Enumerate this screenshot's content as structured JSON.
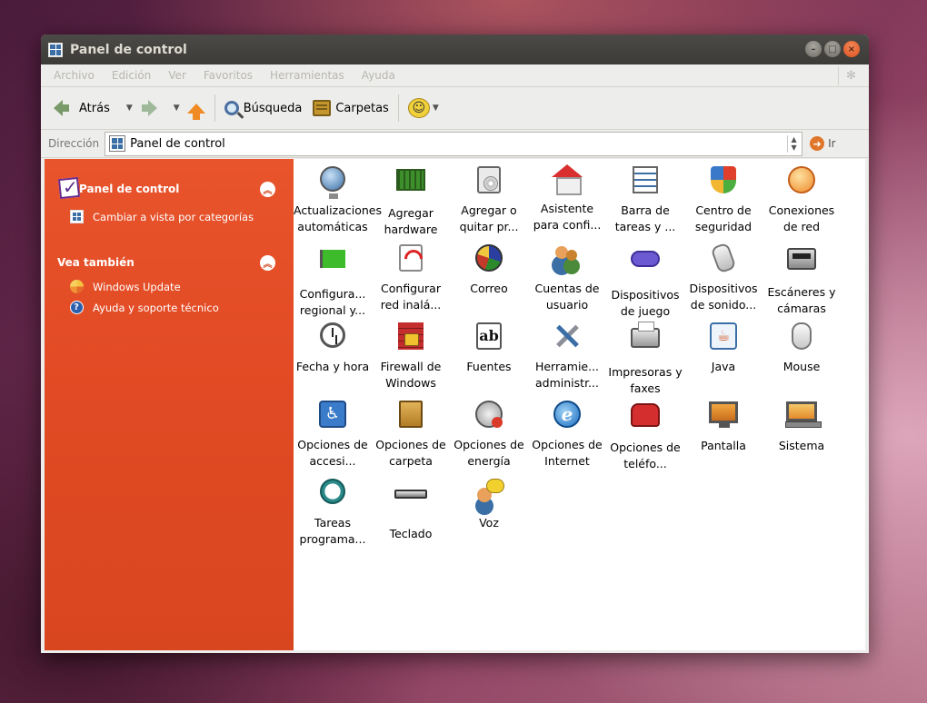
{
  "window": {
    "title": "Panel de control"
  },
  "menubar": {
    "items": [
      "Archivo",
      "Edición",
      "Ver",
      "Favoritos",
      "Herramientas",
      "Ayuda"
    ]
  },
  "toolbar": {
    "back_label": "Atrás",
    "search_label": "Búsqueda",
    "folders_label": "Carpetas"
  },
  "addressbar": {
    "label": "Dirección",
    "value": "Panel de control",
    "go_label": "Ir"
  },
  "sidebar": {
    "panel_title": "Panel de control",
    "panel_link": "Cambiar a vista por categorías",
    "see_also_title": "Vea también",
    "see_also_links": [
      "Windows Update",
      "Ayuda y soporte técnico"
    ]
  },
  "items": [
    {
      "label": "Actualizaciones automáticas",
      "icon": "globe"
    },
    {
      "label": "Agregar hardware",
      "icon": "board"
    },
    {
      "label": "Agregar o quitar pr...",
      "icon": "cd"
    },
    {
      "label": "Asistente para confi...",
      "icon": "house"
    },
    {
      "label": "Barra de tareas y ...",
      "icon": "taskbar"
    },
    {
      "label": "Centro de seguridad",
      "icon": "shield"
    },
    {
      "label": "Conexiones de red",
      "icon": "netglobe"
    },
    {
      "label": "Configura... regional y...",
      "icon": "flag"
    },
    {
      "label": "Configurar red inalá...",
      "icon": "wifi"
    },
    {
      "label": "Correo",
      "icon": "mail"
    },
    {
      "label": "Cuentas de usuario",
      "icon": "users"
    },
    {
      "label": "Dispositivos de juego",
      "icon": "gamepad"
    },
    {
      "label": "Dispositivos de sonido...",
      "icon": "sound"
    },
    {
      "label": "Escáneres y cámaras",
      "icon": "scanner"
    },
    {
      "label": "Fecha y hora",
      "icon": "clock"
    },
    {
      "label": "Firewall de Windows",
      "icon": "firewall"
    },
    {
      "label": "Fuentes",
      "icon": "fonts"
    },
    {
      "label": "Herramie... administr...",
      "icon": "tools"
    },
    {
      "label": "Impresoras y faxes",
      "icon": "printer"
    },
    {
      "label": "Java",
      "icon": "java"
    },
    {
      "label": "Mouse",
      "icon": "mouse"
    },
    {
      "label": "Opciones de accesi...",
      "icon": "access"
    },
    {
      "label": "Opciones de carpeta",
      "icon": "folderopt"
    },
    {
      "label": "Opciones de energía",
      "icon": "energy"
    },
    {
      "label": "Opciones de Internet",
      "icon": "ie"
    },
    {
      "label": "Opciones de teléfo...",
      "icon": "phone"
    },
    {
      "label": "Pantalla",
      "icon": "monitor"
    },
    {
      "label": "Sistema",
      "icon": "system"
    },
    {
      "label": "Tareas programa...",
      "icon": "tasks"
    },
    {
      "label": "Teclado",
      "icon": "keyboard"
    },
    {
      "label": "Voz",
      "icon": "voice"
    }
  ]
}
